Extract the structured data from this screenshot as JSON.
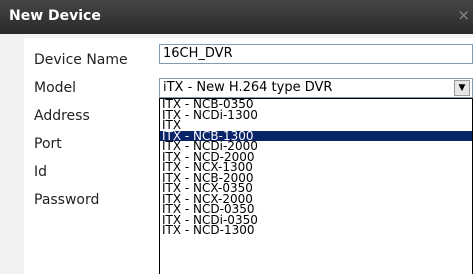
{
  "window": {
    "title": "New Device",
    "close_glyph": "×"
  },
  "form": {
    "labels": {
      "device_name": "Device Name",
      "model": "Model",
      "address": "Address",
      "port": "Port",
      "id": "Id",
      "password": "Password"
    },
    "device_name_value": "16CH_DVR",
    "model_selected": "iTX - New H.264 type DVR",
    "dropdown_arrow": "▼"
  },
  "model_options": [
    "ITX - NCB-0350",
    "ITX - NCDi-1300",
    "ITX",
    "ITX - NCB-1300",
    "ITX - NCDi-2000",
    "ITX - NCD-2000",
    "ITX - NCX-1300",
    "ITX - NCB-2000",
    "ITX - NCX-0350",
    "ITX - NCX-2000",
    "ITX - NCD-0350",
    "ITX - NCDi-0350",
    "ITX - NCD-1300"
  ],
  "highlighted_option": "ITX - NCB-1300"
}
